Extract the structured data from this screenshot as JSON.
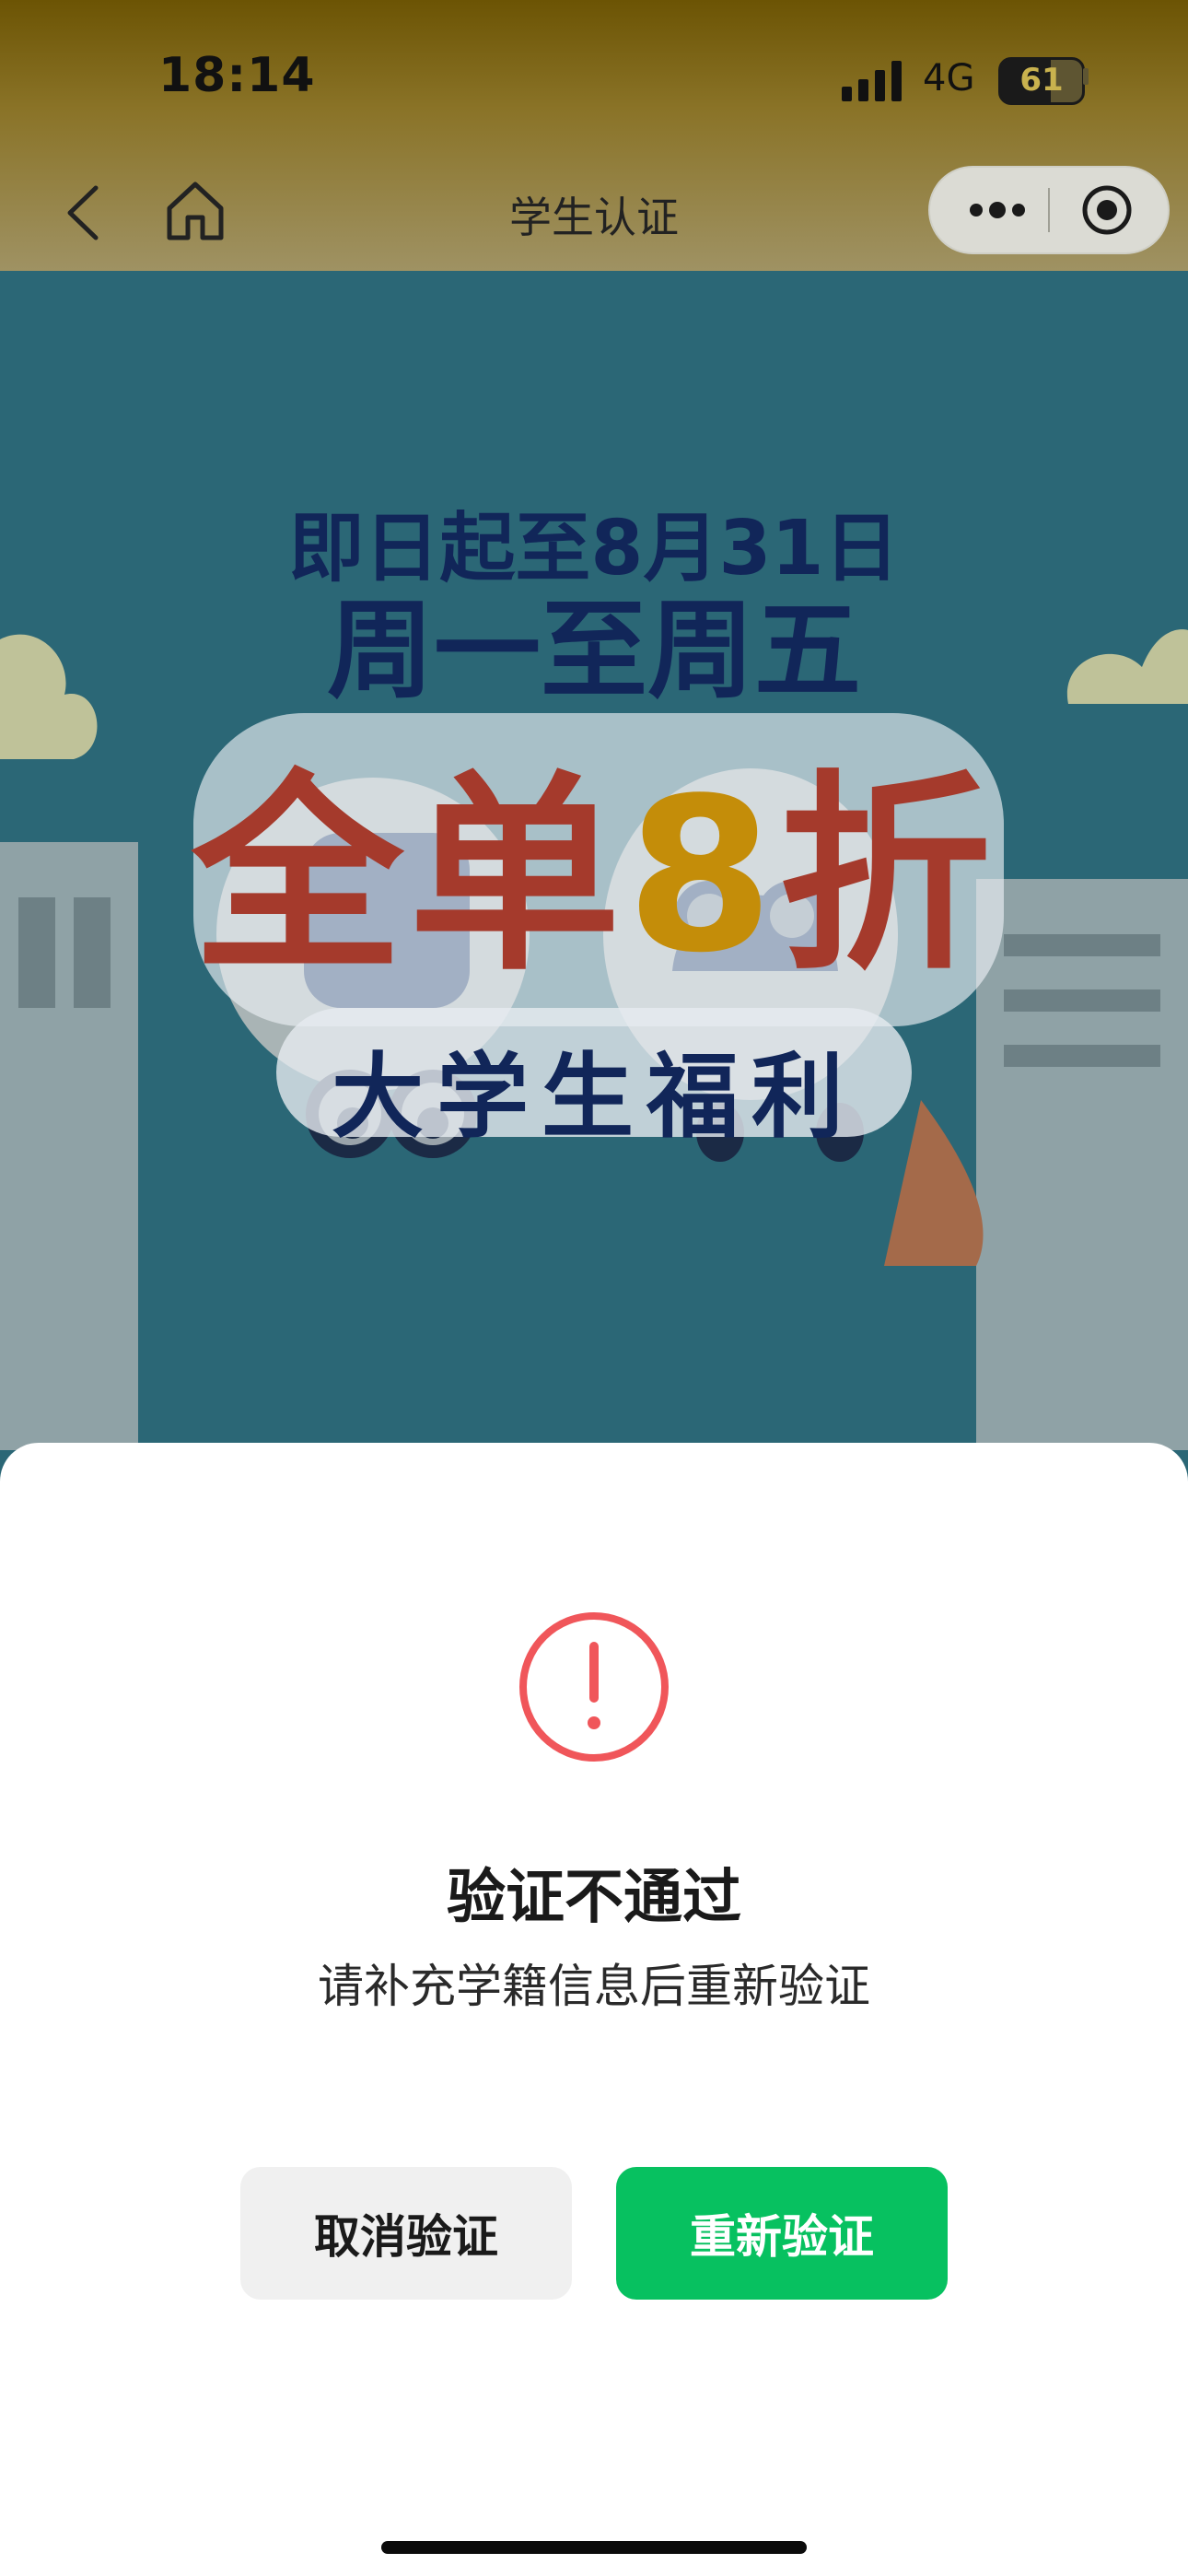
{
  "status_bar": {
    "time": "18:14",
    "network": "4G",
    "battery": "61"
  },
  "nav": {
    "title": "学生认证"
  },
  "banner": {
    "line1": "即日起至8月31日",
    "line2": "周一至周五",
    "main_a": "全单",
    "main_num": "8",
    "main_b": "折",
    "sub": "大学生福利"
  },
  "dialog": {
    "title": "验证不通过",
    "description": "请补充学籍信息后重新验证",
    "cancel_label": "取消验证",
    "retry_label": "重新验证"
  },
  "colors": {
    "accent": "#07c160",
    "warning": "#f0565a",
    "overlay_header": "#6c5404"
  }
}
